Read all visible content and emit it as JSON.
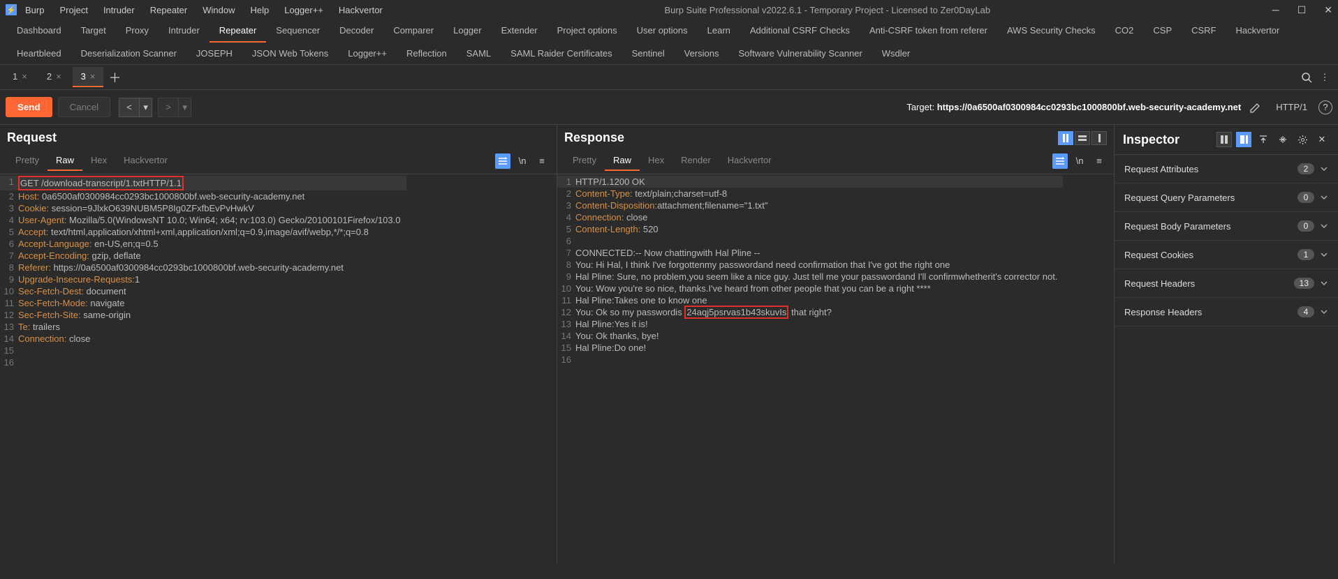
{
  "window": {
    "title": "Burp Suite Professional v2022.6.1 - Temporary Project - Licensed to Zer0DayLab",
    "menus": [
      "Burp",
      "Project",
      "Intruder",
      "Repeater",
      "Window",
      "Help",
      "Logger++",
      "Hackvertor"
    ]
  },
  "main_tabs": {
    "items": [
      "Dashboard",
      "Target",
      "Proxy",
      "Intruder",
      "Repeater",
      "Sequencer",
      "Decoder",
      "Comparer",
      "Logger",
      "Extender",
      "Project options",
      "User options",
      "Learn",
      "Additional CSRF Checks",
      "Anti-CSRF token from referer",
      "AWS Security Checks",
      "CO2",
      "CSP",
      "CSRF",
      "Hackvertor",
      "Heartbleed",
      "Deserialization Scanner",
      "JOSEPH",
      "JSON Web Tokens",
      "Logger++",
      "Reflection",
      "SAML",
      "SAML Raider Certificates",
      "Sentinel",
      "Versions",
      "Software Vulnerability Scanner",
      "Wsdler"
    ],
    "active": "Repeater"
  },
  "repeater_tabs": {
    "items": [
      "1",
      "2",
      "3"
    ],
    "active": "3"
  },
  "actions": {
    "send": "Send",
    "cancel": "Cancel",
    "target_label": "Target:",
    "target_url": "https://0a6500af0300984cc0293bc1000800bf.web-security-academy.net",
    "http_version": "HTTP/1"
  },
  "request": {
    "title": "Request",
    "tabs": [
      "Pretty",
      "Raw",
      "Hex",
      "Hackvertor"
    ],
    "active_tab": "Raw",
    "highlight_line": 1,
    "lines": [
      {
        "raw": "GET /download-transcript/1.txtHTTP/1.1"
      },
      {
        "name": "Host:",
        "value": " 0a6500af0300984cc0293bc1000800bf.web-security-academy.net"
      },
      {
        "name": "Cookie:",
        "value": " session=9JlxkO639NUBM5P8Ig0ZFxfbEvPvHwkV"
      },
      {
        "name": "User-Agent:",
        "value": " Mozilla/5.0(WindowsNT 10.0; Win64; x64; rv:103.0) Gecko/20100101Firefox/103.0"
      },
      {
        "name": "Accept:",
        "value": " text/html,application/xhtml+xml,application/xml;q=0.9,image/avif/webp,*/*;q=0.8"
      },
      {
        "name": "Accept-Language:",
        "value": " en-US,en;q=0.5"
      },
      {
        "name": "Accept-Encoding:",
        "value": " gzip, deflate"
      },
      {
        "name": "Referer:",
        "value": " https://0a6500af0300984cc0293bc1000800bf.web-security-academy.net"
      },
      {
        "name": "Upgrade-Insecure-Requests:",
        "value": "1"
      },
      {
        "name": "Sec-Fetch-Dest:",
        "value": " document"
      },
      {
        "name": "Sec-Fetch-Mode:",
        "value": " navigate"
      },
      {
        "name": "Sec-Fetch-Site:",
        "value": " same-origin"
      },
      {
        "name": "Te:",
        "value": " trailers"
      },
      {
        "name": "Connection:",
        "value": " close"
      },
      {
        "raw": ""
      },
      {
        "raw": ""
      }
    ]
  },
  "response": {
    "title": "Response",
    "tabs": [
      "Pretty",
      "Raw",
      "Hex",
      "Render",
      "Hackvertor"
    ],
    "active_tab": "Raw",
    "highlight_line": 12,
    "highlight_text": "24aqj5psrvas1b43skuvIs",
    "lines": [
      {
        "raw": "HTTP/1.1200 OK"
      },
      {
        "name": "Content-Type:",
        "value": " text/plain;charset=utf-8"
      },
      {
        "name": "Content-Disposition:",
        "value": "attachment;filename=\"1.txt\""
      },
      {
        "name": "Connection:",
        "value": " close"
      },
      {
        "name": "Content-Length:",
        "value": " 520"
      },
      {
        "raw": ""
      },
      {
        "raw": "CONNECTED:-- Now chattingwith Hal Pline --"
      },
      {
        "raw": "You: Hi Hal, I think I've forgottenmy passwordand need confirmation that I've got the right one"
      },
      {
        "raw": "Hal Pline: Sure, no problem,you seem like a nice guy. Just tell me your passwordand I'll confirmwhetherit's corrector not."
      },
      {
        "raw": "You: Wow you're so nice, thanks.I've heard from other people that you can be a right ****"
      },
      {
        "raw": "Hal Pline:Takes one to know one"
      },
      {
        "raw": "You: Ok so my passwordis 24aqj5psrvas1b43skuvIs that right?"
      },
      {
        "raw": "Hal Pline:Yes it is!"
      },
      {
        "raw": "You: Ok thanks, bye!"
      },
      {
        "raw": "Hal Pline:Do one!"
      },
      {
        "raw": ""
      }
    ]
  },
  "inspector": {
    "title": "Inspector",
    "rows": [
      {
        "label": "Request Attributes",
        "count": "2"
      },
      {
        "label": "Request Query Parameters",
        "count": "0"
      },
      {
        "label": "Request Body Parameters",
        "count": "0"
      },
      {
        "label": "Request Cookies",
        "count": "1"
      },
      {
        "label": "Request Headers",
        "count": "13"
      },
      {
        "label": "Response Headers",
        "count": "4"
      }
    ]
  }
}
